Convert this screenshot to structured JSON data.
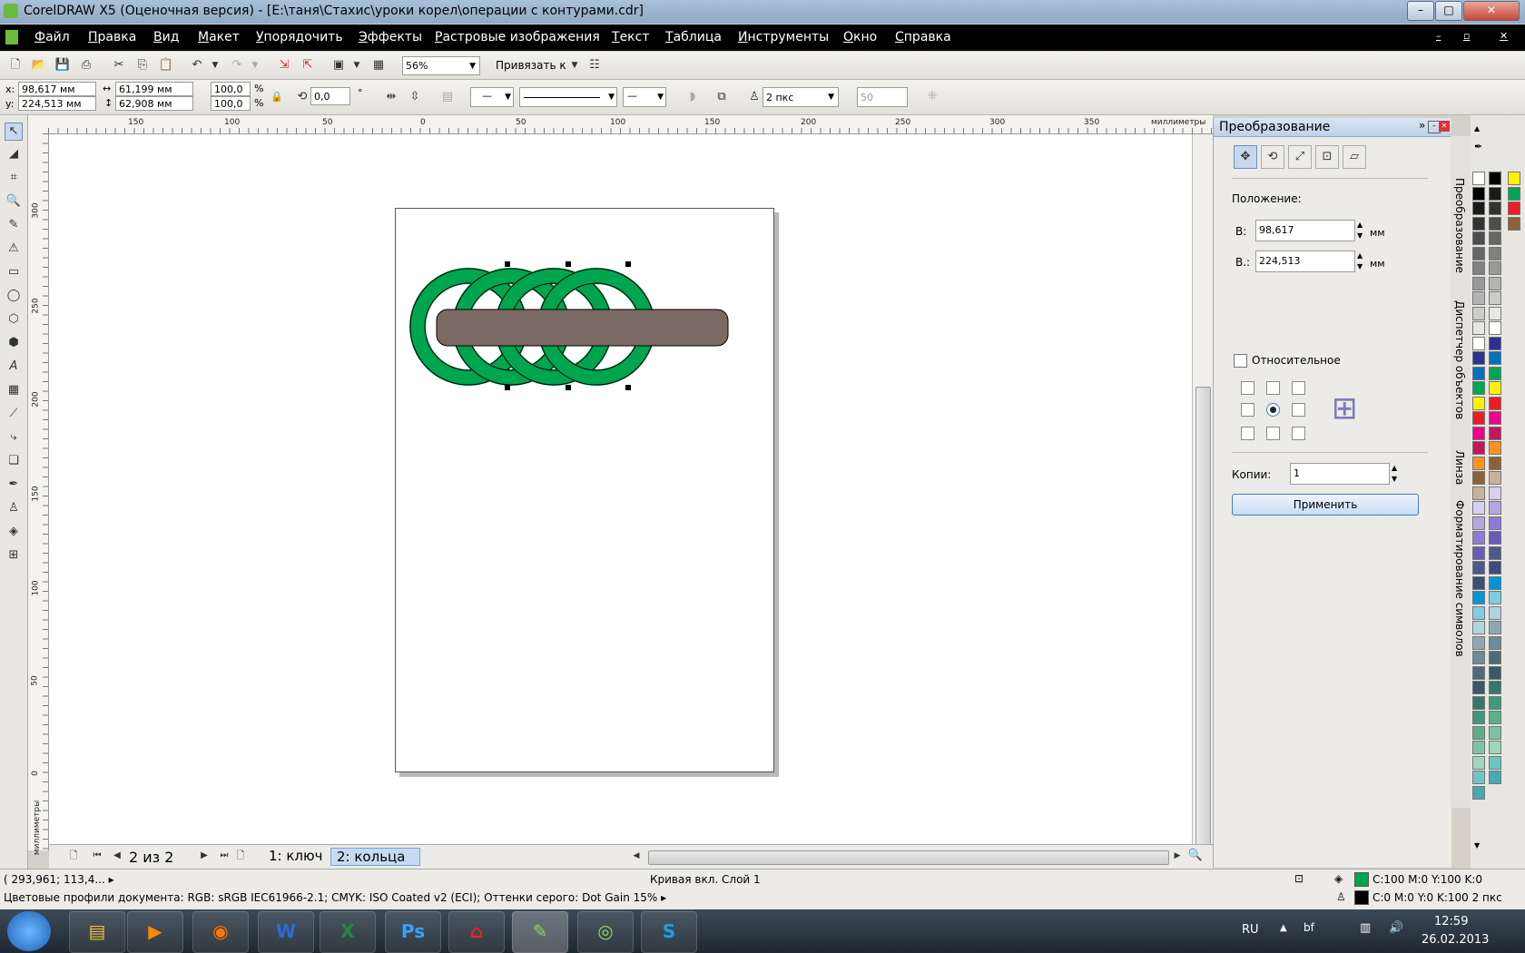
{
  "window": {
    "title": "CorelDRAW X5 (Оценочная версия) - [E:\\таня\\Стахис\\уроки корел\\операции с контурами.cdr]",
    "min": "–",
    "max": "□",
    "close": "✕"
  },
  "menu": [
    "Файл",
    "Правка",
    "Вид",
    "Макет",
    "Упорядочить",
    "Эффекты",
    "Растровые изображения",
    "Текст",
    "Таблица",
    "Инструменты",
    "Окно",
    "Справка"
  ],
  "menu_controls": {
    "min": "–",
    "restore": "▫",
    "close": "✕"
  },
  "toolbar": {
    "zoom": "56%",
    "snap_label": "Привязать к"
  },
  "props": {
    "x_label": "x:",
    "x": "98,617 мм",
    "y_label": "y:",
    "y": "224,513 мм",
    "w": "61,199 мм",
    "h": "62,908 мм",
    "sx": "100,0",
    "sy": "100,0",
    "pct": "%",
    "angle": "0,0",
    "deg": "°",
    "outline_width": "2 пкс",
    "nudge": "50"
  },
  "ruler_h": [
    "150",
    "100",
    "50",
    "0",
    "50",
    "100",
    "150",
    "200",
    "250",
    "300",
    "350"
  ],
  "ruler_units": "миллиметры",
  "ruler_v": [
    "300",
    "250",
    "200",
    "150",
    "100",
    "50",
    "0"
  ],
  "ruler_v_units": "миллиметры",
  "page_nav": {
    "counter": "2 из 2",
    "tabs": [
      "1: ключ",
      "2: кольца"
    ]
  },
  "colors": {
    "ring": "#00a550",
    "bar": "#7b6a63",
    "accent": "#3a7bd5"
  },
  "docker": {
    "title": "Преобразование",
    "position_label": "Положение:",
    "x_label": "В:",
    "x": "98,617",
    "unit": "мм",
    "y_label": "В.:",
    "y": "224,513",
    "relative": "Относительное",
    "copies_label": "Копии:",
    "copies": "1",
    "apply": "Применить",
    "side_tabs": [
      "Преобразование",
      "Диспетчер объектов",
      "Линза",
      "Форматирование символов"
    ]
  },
  "status": {
    "coords": "( 293,961; 113,4... ▸",
    "object": "Кривая вкл. Слой 1",
    "profiles": "Цветовые профили документа: RGB: sRGB IEC61966-2.1; CMYK: ISO Coated v2 (ECI); Оттенки серого: Dot Gain 15% ▸",
    "fill": "C:100 M:0 Y:100 K:0",
    "outline": "C:0 M:0 Y:0 K:100  2 пкс"
  },
  "taskbar": {
    "apps": [
      "Проводник",
      "Медиаплеер",
      "Firefox",
      "W",
      "X",
      "Ps",
      "PDF",
      "CorelDRAW",
      "Corel",
      "S"
    ],
    "apps_visible": [
      "W",
      "X",
      "Ps",
      "S"
    ],
    "lang": "RU",
    "time": "12:59",
    "date": "26.02.2013"
  },
  "palette": [
    "#ffffff",
    "#000000",
    "#1a1a1a",
    "#333333",
    "#4d4d4d",
    "#666666",
    "#808080",
    "#999999",
    "#b3b3b3",
    "#cccccc",
    "#e6e6e6",
    "#ffffff",
    "#2e3192",
    "#0072bc",
    "#00a651",
    "#fff200",
    "#ed1c24",
    "#ec008c",
    "#c2185b",
    "#f7941d",
    "#8c6239",
    "#c7b299",
    "#d7d0f0",
    "#b3a6e6",
    "#8c7ad6",
    "#6b5bb8",
    "#4a5a8c",
    "#3d4e7a",
    "#0096d6",
    "#7fcbe8",
    "#b0d4e0",
    "#8ca8b8",
    "#6b8a9a",
    "#4d6a7a",
    "#3a5868",
    "#2f7a6a",
    "#3c9a7c",
    "#5ab08a",
    "#7cc4a0",
    "#9dd8b8",
    "#6cc4c4",
    "#4aa8b0"
  ],
  "palette2": [
    "#000000",
    "#1a1a1a",
    "#333333",
    "#4d4d4d",
    "#666666",
    "#808080",
    "#999999",
    "#b3b3b3",
    "#cccccc",
    "#e6e6e6",
    "#ffffff",
    "#2e3192",
    "#0072bc",
    "#00a651",
    "#fff200",
    "#ed1c24",
    "#ec008c",
    "#c2185b",
    "#f7941d",
    "#8c6239",
    "#c7b299",
    "#d7d0f0",
    "#b3a6e6",
    "#8c7ad6",
    "#6b5bb8",
    "#4a5a8c",
    "#3d4e7a",
    "#0096d6",
    "#7fcbe8",
    "#b0d4e0",
    "#8ca8b8",
    "#6b8a9a",
    "#4d6a7a",
    "#3a5868",
    "#2f7a6a",
    "#3c9a7c",
    "#5ab08a",
    "#7cc4a0",
    "#9dd8b8",
    "#6cc4c4",
    "#4aa8b0"
  ],
  "palette3": [
    "#fff200",
    "#00a651",
    "#ed1c24",
    "#8c6239"
  ]
}
